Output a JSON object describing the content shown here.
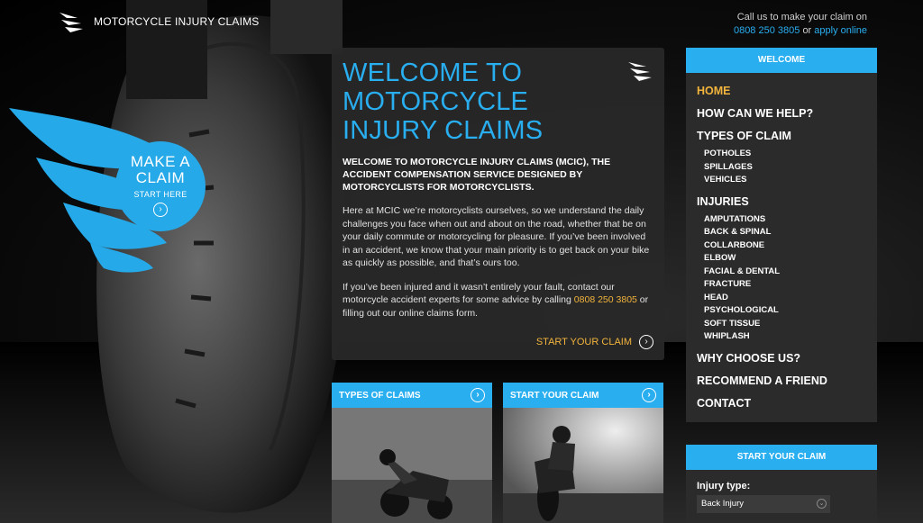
{
  "header": {
    "logo_text": "MOTORCYCLE INJURY CLAIMS",
    "callus_text": "Call us to make your claim on",
    "phone": "0808 250 3805",
    "or_text": "or",
    "apply_online": "apply online"
  },
  "make_claim": {
    "title_line1": "MAKE A",
    "title_line2": "CLAIM",
    "subtitle": "START HERE"
  },
  "welcome": {
    "heading": "WELCOME TO MOTORCYCLE INJURY CLAIMS",
    "lead": "WELCOME TO MOTORCYCLE INJURY CLAIMS (MCIC), THE ACCIDENT COMPENSATION SERVICE DESIGNED BY MOTORCYCLISTS FOR MOTORCYCLISTS.",
    "para1": "Here at MCIC we’re motorcyclists ourselves, so we understand the daily challenges you face when out and about on the road, whether that be on your daily commute or motorcycling for pleasure. If you’ve been involved in an accident, we know that your main priority is to get back on your bike as quickly as possible, and that’s ours too.",
    "para2_before": "If you’ve been injured and it wasn’t entirely your fault, contact our motorcycle accident experts for some advice by calling",
    "para2_phone": "0808 250 3805",
    "para2_after": "or filling out our online claims form.",
    "cta": "START YOUR CLAIM"
  },
  "cards": [
    {
      "title": "TYPES OF CLAIMS"
    },
    {
      "title": "START YOUR CLAIM"
    }
  ],
  "nav": {
    "header": "WELCOME",
    "home": "HOME",
    "how_help": "HOW CAN WE HELP?",
    "types": "TYPES OF CLAIM",
    "types_items": [
      "POTHOLES",
      "SPILLAGES",
      "VEHICLES"
    ],
    "injuries": "INJURIES",
    "injury_items": [
      "AMPUTATIONS",
      "BACK & SPINAL",
      "COLLARBONE",
      "ELBOW",
      "FACIAL & DENTAL",
      "FRACTURE",
      "HEAD",
      "PSYCHOLOGICAL",
      "SOFT TISSUE",
      "WHIPLASH"
    ],
    "why": "WHY CHOOSE US?",
    "recommend": "RECOMMEND A FRIEND",
    "contact": "CONTACT"
  },
  "claim_form": {
    "header": "START YOUR CLAIM",
    "injury_label": "Injury type:",
    "injury_value": "Back Injury"
  },
  "colors": {
    "accent_blue": "#29aef0",
    "accent_gold": "#f2b43c",
    "panel": "#2b2b2b"
  },
  "icons": {
    "logo": "wing-logo-icon",
    "arrow": "circle-arrow-right-icon",
    "select": "chevron-down-icon"
  }
}
